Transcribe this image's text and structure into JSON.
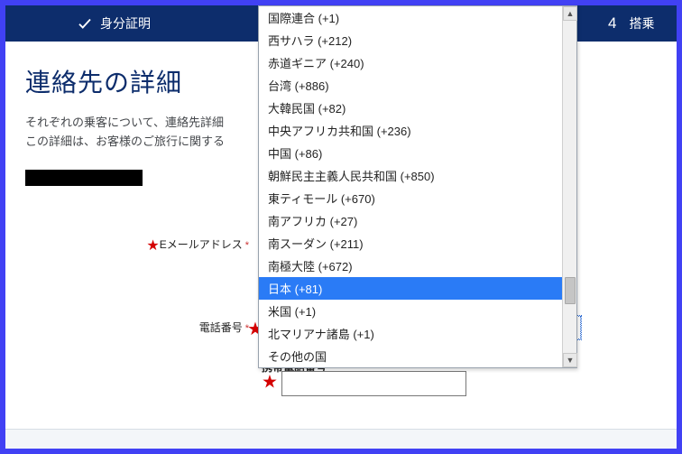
{
  "stepbar": {
    "step1": {
      "label": "身分証明"
    },
    "step4": {
      "number": "4",
      "label": "搭乗"
    }
  },
  "page": {
    "title": "連絡先の詳細",
    "desc_line1": "それぞれの乗客について、連絡先詳細",
    "desc_line2": "この詳細は、お客様のご旅行に関する"
  },
  "labels": {
    "email": "Eメールアドレス",
    "phone": "電話番号",
    "mobile": "携帯電話番号"
  },
  "select": {
    "value": "日本 (+81)"
  },
  "dropdown": {
    "selected_index": 12,
    "options": [
      "国際連合 (+1)",
      "西サハラ (+212)",
      "赤道ギニア (+240)",
      "台湾 (+886)",
      "大韓民国 (+82)",
      "中央アフリカ共和国 (+236)",
      "中国 (+86)",
      "朝鮮民主主義人民共和国 (+850)",
      "東ティモール (+670)",
      "南アフリカ (+27)",
      "南スーダン (+211)",
      "南極大陸 (+672)",
      "日本 (+81)",
      "米国 (+1)",
      "北マリアナ諸島 (+1)",
      "その他の国"
    ]
  }
}
